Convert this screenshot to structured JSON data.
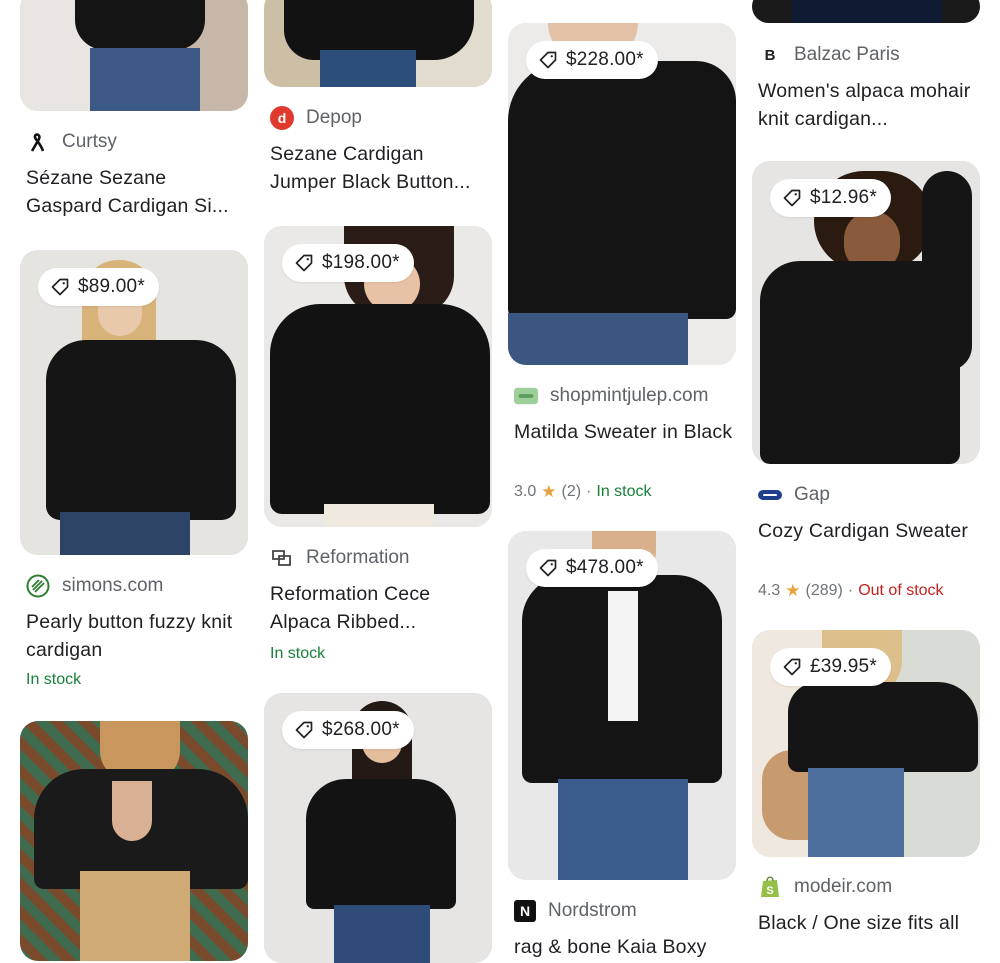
{
  "colors": {
    "in_stock": "#188038",
    "out_of_stock": "#c5221f",
    "star": "#e7a33e",
    "source_text": "#5f6368"
  },
  "col1": {
    "c1": {
      "source": "Curtsy",
      "logo_icon": "curtsy-logo-icon",
      "title": "Sézane Sezane Gaspard Cardigan Si..."
    },
    "c2": {
      "price": "$89.00*",
      "source": "simons.com",
      "logo_icon": "simons-logo-icon",
      "title": "Pearly button fuzzy knit cardigan",
      "stock": "In stock"
    }
  },
  "col2": {
    "c1": {
      "source": "Depop",
      "logo_icon": "depop-logo-icon",
      "title": "Sezane Cardigan Jumper Black Button..."
    },
    "c2": {
      "price": "$198.00*",
      "source": "Reformation",
      "logo_icon": "reformation-logo-icon",
      "title": "Reformation Cece Alpaca Ribbed...",
      "stock": "In stock"
    },
    "c3": {
      "price": "$268.00*"
    }
  },
  "col3": {
    "c1": {
      "price": "$228.00*",
      "source": "shopmintjulep.com",
      "logo_icon": "mintjulep-logo-icon",
      "title": "Matilda Sweater in Black",
      "rating": "3.0",
      "reviews": "(2)",
      "sep": "·",
      "stock": "In stock"
    },
    "c2": {
      "price": "$478.00*",
      "source": "Nordstrom",
      "logo_icon": "nordstrom-logo-icon",
      "logo_letter": "N",
      "title": "rag & bone Kaia Boxy"
    }
  },
  "col4": {
    "c1": {
      "source": "Balzac Paris",
      "logo_icon": "balzac-logo-icon",
      "logo_letter": "B",
      "title": "Women's alpaca mohair knit cardigan..."
    },
    "c2": {
      "price": "$12.96*",
      "source": "Gap",
      "logo_icon": "gap-logo-icon",
      "title": "Cozy Cardigan Sweater",
      "rating": "4.3",
      "reviews": "(289)",
      "sep": "·",
      "stock": "Out of stock"
    },
    "c3": {
      "price": "£39.95*",
      "source": "modeir.com",
      "logo_icon": "shopify-logo-icon",
      "title": "Black / One size fits all"
    }
  }
}
